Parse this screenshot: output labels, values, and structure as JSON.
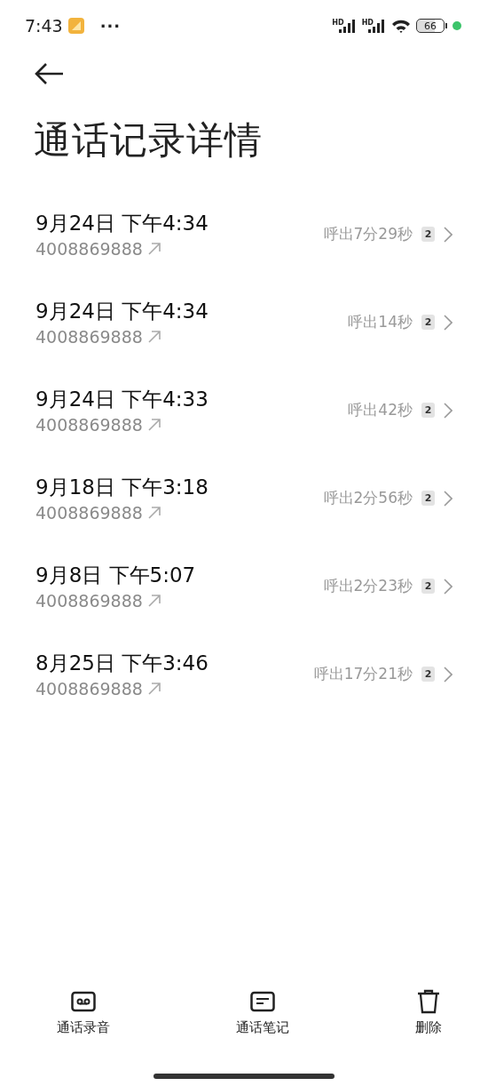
{
  "status_bar": {
    "time": "7:43",
    "more": "···",
    "sim_labels": [
      "HD",
      "HD"
    ],
    "battery": "66"
  },
  "title": "通话记录详情",
  "calls": [
    {
      "date": "9月24日 下午4:34",
      "number": "4008869888",
      "summary": "呼出7分29秒",
      "sim": "2"
    },
    {
      "date": "9月24日 下午4:34",
      "number": "4008869888",
      "summary": "呼出14秒",
      "sim": "2"
    },
    {
      "date": "9月24日 下午4:33",
      "number": "4008869888",
      "summary": "呼出42秒",
      "sim": "2"
    },
    {
      "date": "9月18日 下午3:18",
      "number": "4008869888",
      "summary": "呼出2分56秒",
      "sim": "2"
    },
    {
      "date": "9月8日 下午5:07",
      "number": "4008869888",
      "summary": "呼出2分23秒",
      "sim": "2"
    },
    {
      "date": "8月25日 下午3:46",
      "number": "4008869888",
      "summary": "呼出17分21秒",
      "sim": "2"
    }
  ],
  "actions": [
    {
      "kind": "recording",
      "label": "通话录音"
    },
    {
      "kind": "notes",
      "label": "通话笔记"
    },
    {
      "kind": "delete",
      "label": "删除"
    }
  ]
}
